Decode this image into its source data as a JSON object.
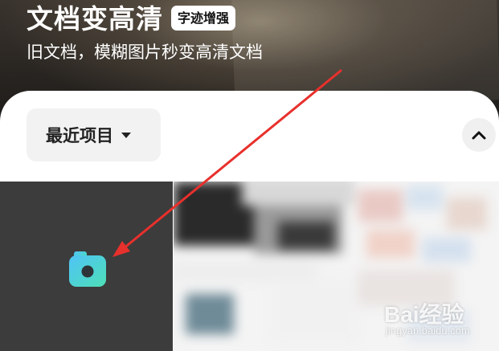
{
  "header": {
    "title": "文档变高清",
    "badge": "字迹增强",
    "subtitle": "旧文档，模糊图片秒变高清文档"
  },
  "toolbar": {
    "recent_label": "最近项目",
    "recent_icon": "caret-down-icon",
    "collapse_icon": "chevron-up-icon"
  },
  "grid": {
    "camera_icon": "camera-icon"
  },
  "watermark": {
    "brand": "Bai经验",
    "url": "jingyan.baidu.com"
  },
  "colors": {
    "arrow": "#e8302c",
    "camera_gradient_start": "#4fc3f7",
    "camera_gradient_end": "#4ee0b6",
    "camera_tile": "#3c3c3c"
  }
}
